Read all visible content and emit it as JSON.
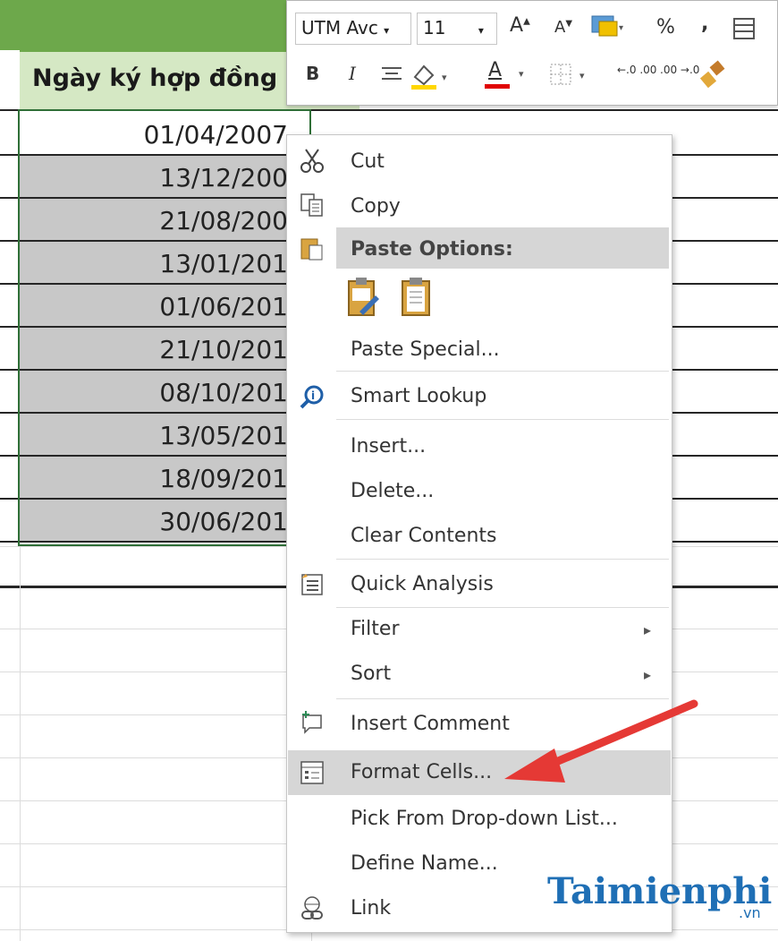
{
  "sheet": {
    "header": "Ngày ký hợp đồng",
    "dates": [
      "01/04/2007",
      "13/12/200",
      "21/08/200",
      "13/01/201",
      "01/06/201",
      "21/10/201",
      "08/10/201",
      "13/05/201",
      "18/09/201",
      "30/06/201"
    ]
  },
  "mini_toolbar": {
    "font_name": "UTM Avc",
    "font_size": "11",
    "grow_font": "A",
    "shrink_font": "A",
    "percent": "%",
    "comma": ",",
    "bold": "B",
    "italic": "I",
    "font_color_label": "A",
    "inc_decimal": "←.0 .00",
    "dec_decimal": ".00 →.0",
    "colors": {
      "fill": "#ffd700",
      "font": "#e00000"
    }
  },
  "context_menu": {
    "cut": "Cut",
    "copy": "Copy",
    "paste_options": "Paste Options:",
    "paste_special": "Paste Special...",
    "smart_lookup": "Smart Lookup",
    "insert": "Insert...",
    "delete": "Delete...",
    "clear_contents": "Clear Contents",
    "quick_analysis": "Quick Analysis",
    "filter": "Filter",
    "sort": "Sort",
    "insert_comment": "Insert Comment",
    "format_cells": "Format Cells...",
    "pick_from_list": "Pick From Drop-down List...",
    "define_name": "Define Name...",
    "link": "Link"
  },
  "watermark": {
    "brand": "Taimienphi",
    "tld": ".vn"
  },
  "colors": {
    "arrow": "#e53935",
    "highlight": "#d6d6d6",
    "header_fill": "#d5e8c4",
    "band": "#6da84b"
  }
}
